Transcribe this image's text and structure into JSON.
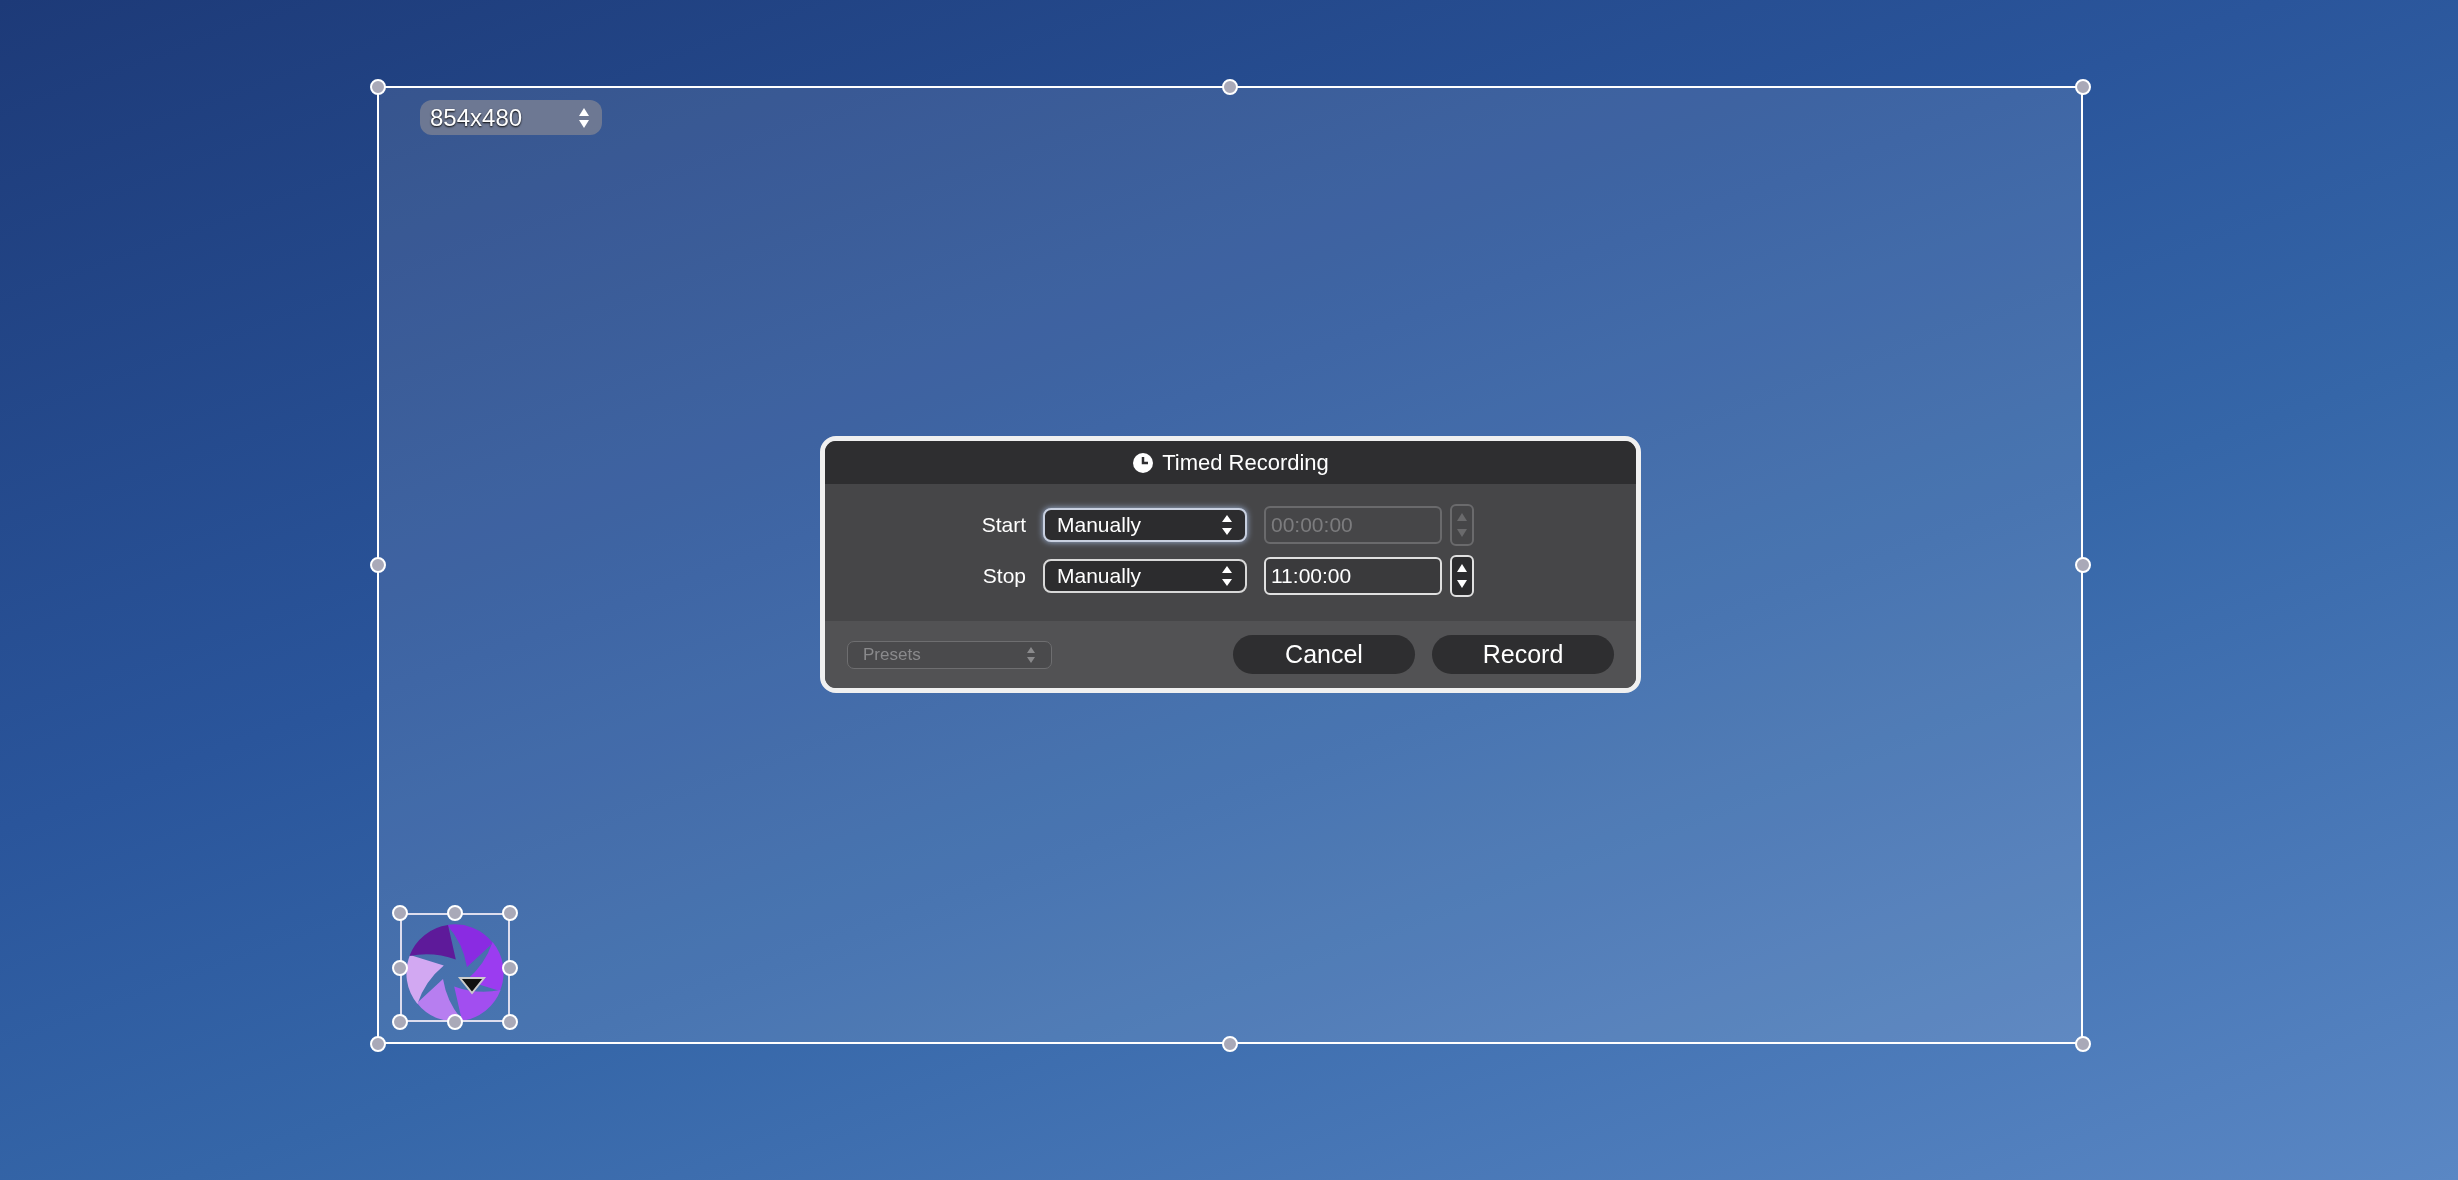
{
  "capture_size": {
    "value": "854x480"
  },
  "dialog": {
    "title": "Timed Recording",
    "rows": [
      {
        "label": "Start",
        "mode": "Manually",
        "focused": true,
        "time": "00:00:00",
        "time_disabled": true
      },
      {
        "label": "Stop",
        "mode": "Manually",
        "focused": false,
        "time": "11:00:00",
        "time_disabled": false
      }
    ],
    "presets": {
      "value": "Presets",
      "disabled": true
    },
    "buttons": [
      "Cancel",
      "Record"
    ]
  }
}
